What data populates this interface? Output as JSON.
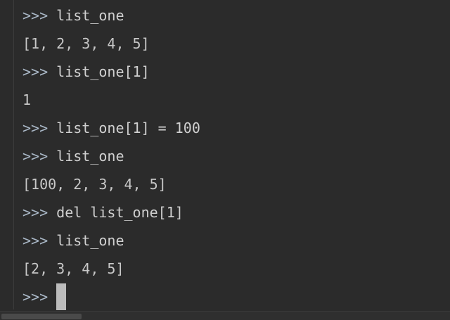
{
  "console": {
    "prompt": ">>>",
    "lines": [
      {
        "kind": "input",
        "text": "list_one"
      },
      {
        "kind": "output",
        "text": "[1, 2, 3, 4, 5]"
      },
      {
        "kind": "input",
        "text": "list_one[1]"
      },
      {
        "kind": "output",
        "text": "1"
      },
      {
        "kind": "input",
        "text": "list_one[1] = 100"
      },
      {
        "kind": "input",
        "text": "list_one"
      },
      {
        "kind": "output",
        "text": "[100, 2, 3, 4, 5]"
      },
      {
        "kind": "input",
        "text": "del list_one[1]"
      },
      {
        "kind": "input",
        "text": "list_one"
      },
      {
        "kind": "output",
        "text": "[2, 3, 4, 5]"
      }
    ],
    "active_input": ""
  },
  "colors": {
    "background": "#2b2b2b",
    "text": "#c8c8c8",
    "cursor": "#bcbcbc"
  }
}
